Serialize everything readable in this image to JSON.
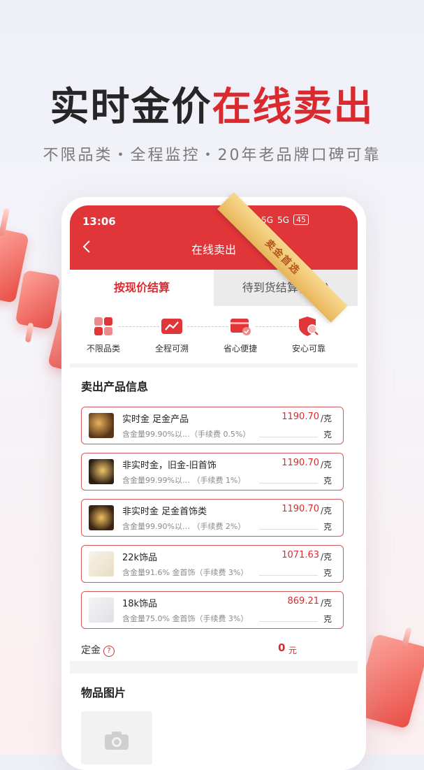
{
  "hero": {
    "title_dark": "实时金价",
    "title_red": "在线卖出",
    "subtitle": "不限品类・全程监控・20年老品牌口碑可靠"
  },
  "status_bar": {
    "time": "13:06",
    "net1": "5G",
    "net2": "5G",
    "battery": "45"
  },
  "nav": {
    "title": "在线卖出"
  },
  "ribbon": {
    "text": "卖金首选"
  },
  "tabs": [
    {
      "label": "按现价结算",
      "active": true
    },
    {
      "label": "待到货结算(入库)",
      "active": false
    }
  ],
  "features": [
    {
      "label": "不限品类",
      "icon": "grid-icon"
    },
    {
      "label": "全程可溯",
      "icon": "trend-chart-icon"
    },
    {
      "label": "省心便捷",
      "icon": "card-check-icon"
    },
    {
      "label": "安心可靠",
      "icon": "shield-search-icon"
    }
  ],
  "sale_info": {
    "title": "卖出产品信息",
    "products": [
      {
        "name": "实时金 足金产品",
        "desc": "含金量99.90%以…（手续费 0.5%）",
        "price": "1190.70",
        "unit": "/克",
        "qty_unit": "克"
      },
      {
        "name": "非实时金，旧金-旧首饰",
        "desc": "含金量99.99%以…  （手续费 1%）",
        "price": "1190.70",
        "unit": "/克",
        "qty_unit": "克"
      },
      {
        "name": "非实时金 足金首饰类",
        "desc": "含金量99.90%以…  （手续费 2%）",
        "price": "1190.70",
        "unit": "/克",
        "qty_unit": "克"
      },
      {
        "name": "22k饰品",
        "desc": "含金量91.6% 金首饰（手续费 3%）",
        "price": "1071.63",
        "unit": "/克",
        "qty_unit": "克"
      },
      {
        "name": "18k饰品",
        "desc": "含金量75.0% 金首饰（手续费 3%）",
        "price": "869.21",
        "unit": "/克",
        "qty_unit": "克"
      }
    ],
    "deposit_label": "定金",
    "deposit_value": "0",
    "deposit_unit": "元"
  },
  "photo": {
    "title": "物品图片"
  },
  "colors": {
    "brand_red": "#e0363a",
    "price_red": "#d92b2f"
  }
}
